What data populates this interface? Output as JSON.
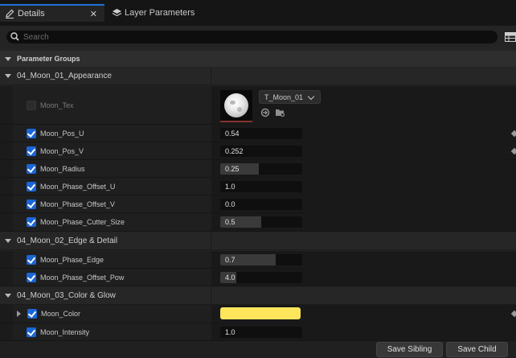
{
  "tabs": [
    {
      "label": "Details",
      "icon": "pencil-icon",
      "active": true
    },
    {
      "label": "Layer Parameters",
      "icon": "layers-icon",
      "active": false
    }
  ],
  "tab_close": "✕",
  "search": {
    "placeholder": "Search"
  },
  "section": {
    "label": "Parameter Groups"
  },
  "groups": [
    {
      "label": "04_Moon_01_Appearance"
    },
    {
      "label": "04_Moon_02_Edge & Detail"
    },
    {
      "label": "04_Moon_03_Color & Glow"
    }
  ],
  "params": {
    "moon_tex": {
      "label": "Moon_Tex",
      "enabled": false,
      "texture": "T_Moon_01"
    },
    "moon_pos_u": {
      "label": "Moon_Pos_U",
      "enabled": true,
      "value": "0.54",
      "fill": 0
    },
    "moon_pos_v": {
      "label": "Moon_Pos_V",
      "enabled": true,
      "value": "0.252",
      "fill": 0
    },
    "moon_radius": {
      "label": "Moon_Radius",
      "enabled": true,
      "value": "0.25",
      "fill": 0.47
    },
    "moon_phase_offset_u": {
      "label": "Moon_Phase_Offset_U",
      "enabled": true,
      "value": "1.0",
      "fill": 0
    },
    "moon_phase_offset_v": {
      "label": "Moon_Phase_Offset_V",
      "enabled": true,
      "value": "0.0",
      "fill": 0
    },
    "moon_phase_cutter_size": {
      "label": "Moon_Phase_Cutter_Size",
      "enabled": true,
      "value": "0.5",
      "fill": 0.5
    },
    "moon_phase_edge": {
      "label": "Moon_Phase_Edge",
      "enabled": true,
      "value": "0.7",
      "fill": 0.68
    },
    "moon_phase_offset_pow": {
      "label": "Moon_Phase_Offset_Pow",
      "enabled": true,
      "value": "4.0",
      "fill": 0.2
    },
    "moon_color": {
      "label": "Moon_Color",
      "enabled": true,
      "color": "#fde65c"
    },
    "moon_intensity": {
      "label": "Moon_Intensity",
      "enabled": true,
      "value": "1.0",
      "fill": 0
    }
  },
  "buttons": {
    "save_sibling": "Save Sibling",
    "save_child": "Save Child"
  },
  "colors": {
    "accent": "#1a66d6",
    "moon_color": "#fde65c"
  }
}
